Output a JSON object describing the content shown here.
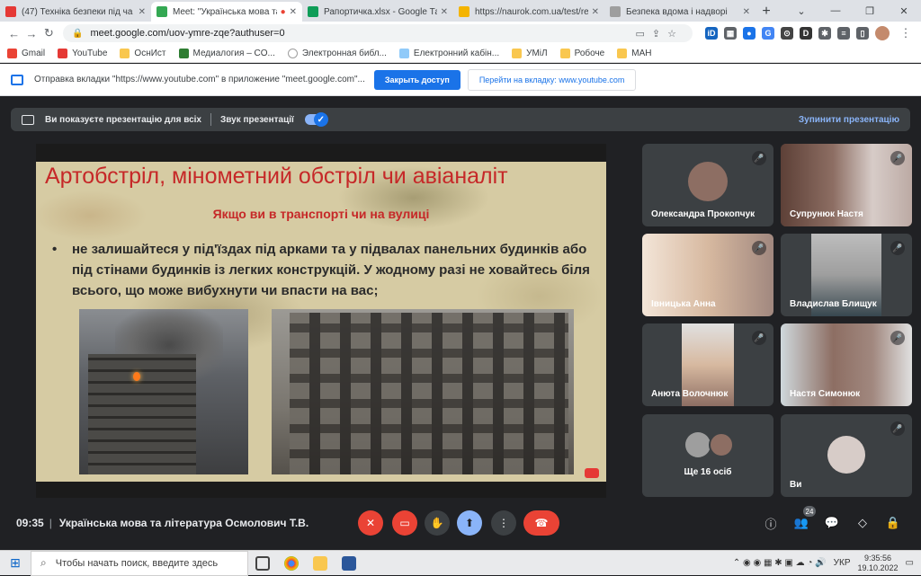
{
  "browser": {
    "tabs": [
      {
        "title": "(47) Техніка безпеки під ча",
        "color": "#e53935"
      },
      {
        "title": "Meet: \"Українська мова та",
        "color": "#34a853"
      },
      {
        "title": "Рапортичка.xlsx - Google Табл",
        "color": "#0f9d58"
      },
      {
        "title": "https://naurok.com.ua/test/rea",
        "color": "#f4b400"
      },
      {
        "title": "Безпека вдома і надворі",
        "color": "#9e9e9e"
      }
    ],
    "url": "meet.google.com/uov-ymre-zqe?authuser=0"
  },
  "bookmarks": [
    {
      "label": "Gmail",
      "color": "#ea4335"
    },
    {
      "label": "YouTube",
      "color": "#e53935"
    },
    {
      "label": "ОснИст",
      "color": "#f9c74f"
    },
    {
      "label": "Медиалогия – CO...",
      "color": "#2e7d32"
    },
    {
      "label": "Электронная библ...",
      "color": "#ffffff"
    },
    {
      "label": "Електронний кабін...",
      "color": "#90caf9"
    },
    {
      "label": "УМіЛ",
      "color": "#f9c74f"
    },
    {
      "label": "Робоче",
      "color": "#f9c74f"
    },
    {
      "label": "МАН",
      "color": "#f9c74f"
    }
  ],
  "infobar": {
    "message": "Отправка вкладки \"https://www.youtube.com\" в приложение \"meet.google.com\"...",
    "primary": "Закрыть доступ",
    "secondary": "Перейти на вкладку: www.youtube.com"
  },
  "presenting": {
    "label": "Ви показуєте презентацію для всіх",
    "audio": "Звук презентації",
    "stop": "Зупинити презентацію"
  },
  "slide": {
    "title": "Артобстріл, мінометний обстріл чи авіаналіт",
    "subtitle": "Якщо ви в транспорті чи на вулиці",
    "bullet": "•",
    "text": "не залишайтеся у під'їздах під арками та у підвалах панельних будинків або під стінами будинків із легких конструкцій. У жодному разі не ховайтесь біля всього, що може вибухнути чи впасти на вас;"
  },
  "participants": [
    {
      "name": "Олександра Прокопчук"
    },
    {
      "name": "Супрунюк Настя"
    },
    {
      "name": "Івницька Анна"
    },
    {
      "name": "Владислав Блищук"
    },
    {
      "name": "Анюта Волочнюк"
    },
    {
      "name": "Настя Симонюк"
    },
    {
      "name": "Ще 16 осіб"
    },
    {
      "name": "Ви"
    }
  ],
  "meeting": {
    "time": "09:35",
    "title": "Українська мова та література Осмолович Т.В.",
    "participant_count": "24"
  },
  "taskbar": {
    "search": "Чтобы начать поиск, введите здесь",
    "lang": "УКР",
    "time": "9:35:56",
    "date": "19.10.2022"
  }
}
